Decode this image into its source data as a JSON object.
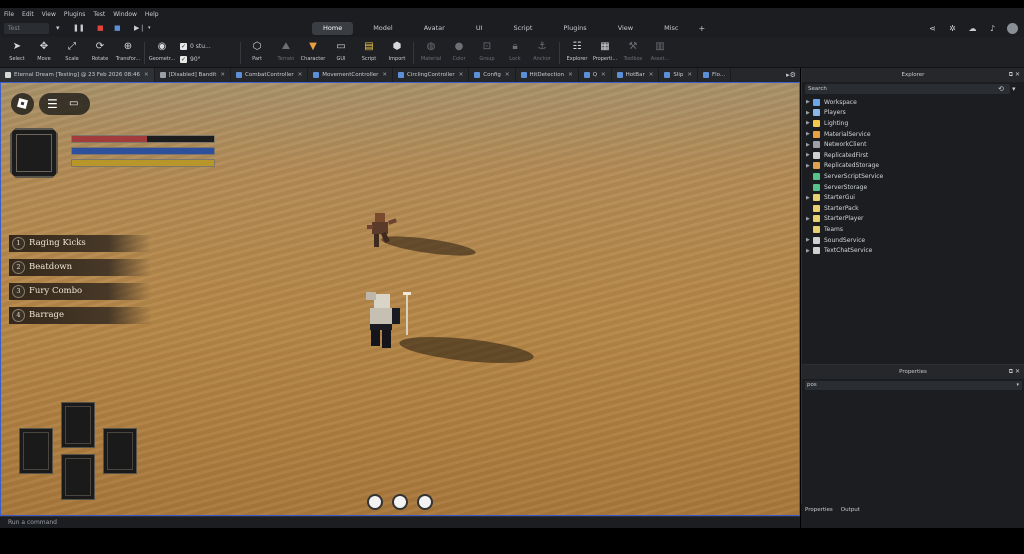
{
  "menu": [
    "File",
    "Edit",
    "View",
    "Plugins",
    "Test",
    "Window",
    "Help"
  ],
  "ribbon": {
    "test_mode": "Test",
    "tabs": [
      "Home",
      "Model",
      "Avatar",
      "UI",
      "Script",
      "Plugins",
      "View",
      "Misc"
    ],
    "active_tab": "Home",
    "add_tab": "+"
  },
  "toolbar": {
    "tools": [
      {
        "label": "Select"
      },
      {
        "label": "Move"
      },
      {
        "label": "Scale"
      },
      {
        "label": "Rotate"
      },
      {
        "label": "Transfor..."
      },
      {
        "label": "Geometr..."
      },
      {
        "label": "Part"
      },
      {
        "label": "Terrain"
      },
      {
        "label": "Character"
      },
      {
        "label": "GUI"
      },
      {
        "label": "Script"
      },
      {
        "label": "Import"
      },
      {
        "label": "Material"
      },
      {
        "label": "Color"
      },
      {
        "label": "Group"
      },
      {
        "label": "Lock"
      },
      {
        "label": "Anchor"
      },
      {
        "label": "Explorer"
      },
      {
        "label": "Properti..."
      },
      {
        "label": "Toolbox"
      },
      {
        "label": "Asset..."
      }
    ],
    "snap_move": "0 stu...",
    "snap_rotate": "90°"
  },
  "doc_tabs": [
    {
      "label": "Eternal Dream [Testing] @ 23 Feb 2026 08:46"
    },
    {
      "label": "[Disabled] Bandit"
    },
    {
      "label": "CombatController"
    },
    {
      "label": "MovementController"
    },
    {
      "label": "CirclingController"
    },
    {
      "label": "Config"
    },
    {
      "label": "HitDetection"
    },
    {
      "label": "Q"
    },
    {
      "label": "HotBar"
    },
    {
      "label": "Slip"
    },
    {
      "label": "Flo..."
    }
  ],
  "game": {
    "health_fraction": 0.53,
    "mana_fraction": 1.0,
    "stamina_fraction": 1.0,
    "skills": [
      {
        "num": "1",
        "name": "Raging Kicks"
      },
      {
        "num": "2",
        "name": "Beatdown"
      },
      {
        "num": "3",
        "name": "Fury Combo"
      },
      {
        "num": "4",
        "name": "Barrage"
      }
    ]
  },
  "command_bar": {
    "placeholder": "Run a command"
  },
  "explorer": {
    "title": "Explorer",
    "search_placeholder": "Search",
    "items": [
      {
        "name": "Workspace",
        "expandable": true,
        "icon_color": "#6aa6e8"
      },
      {
        "name": "Players",
        "expandable": true,
        "icon_color": "#8ab8e8"
      },
      {
        "name": "Lighting",
        "expandable": true,
        "icon_color": "#f2c94c"
      },
      {
        "name": "MaterialService",
        "expandable": true,
        "icon_color": "#e8a040"
      },
      {
        "name": "NetworkClient",
        "expandable": true,
        "icon_color": "#9aa0a6"
      },
      {
        "name": "ReplicatedFirst",
        "expandable": true,
        "icon_color": "#d0d0d0"
      },
      {
        "name": "ReplicatedStorage",
        "expandable": true,
        "icon_color": "#e0a050"
      },
      {
        "name": "ServerScriptService",
        "expandable": false,
        "icon_color": "#58c08a"
      },
      {
        "name": "ServerStorage",
        "expandable": false,
        "icon_color": "#58c08a"
      },
      {
        "name": "StarterGui",
        "expandable": true,
        "icon_color": "#e8d070"
      },
      {
        "name": "StarterPack",
        "expandable": false,
        "icon_color": "#e8d070"
      },
      {
        "name": "StarterPlayer",
        "expandable": true,
        "icon_color": "#e8d070"
      },
      {
        "name": "Teams",
        "expandable": false,
        "icon_color": "#e8d070"
      },
      {
        "name": "SoundService",
        "expandable": true,
        "icon_color": "#d0d0d0"
      },
      {
        "name": "TextChatService",
        "expandable": true,
        "icon_color": "#d0d0d0"
      }
    ]
  },
  "properties": {
    "title": "Properties",
    "filter_value": "pos",
    "tabs": [
      "Properties",
      "Output"
    ]
  },
  "colors": {
    "health": "#a23b3b",
    "mana": "#2d4f9c",
    "stamina": "#b8962a",
    "viewport_border": "#3b5ec9"
  }
}
